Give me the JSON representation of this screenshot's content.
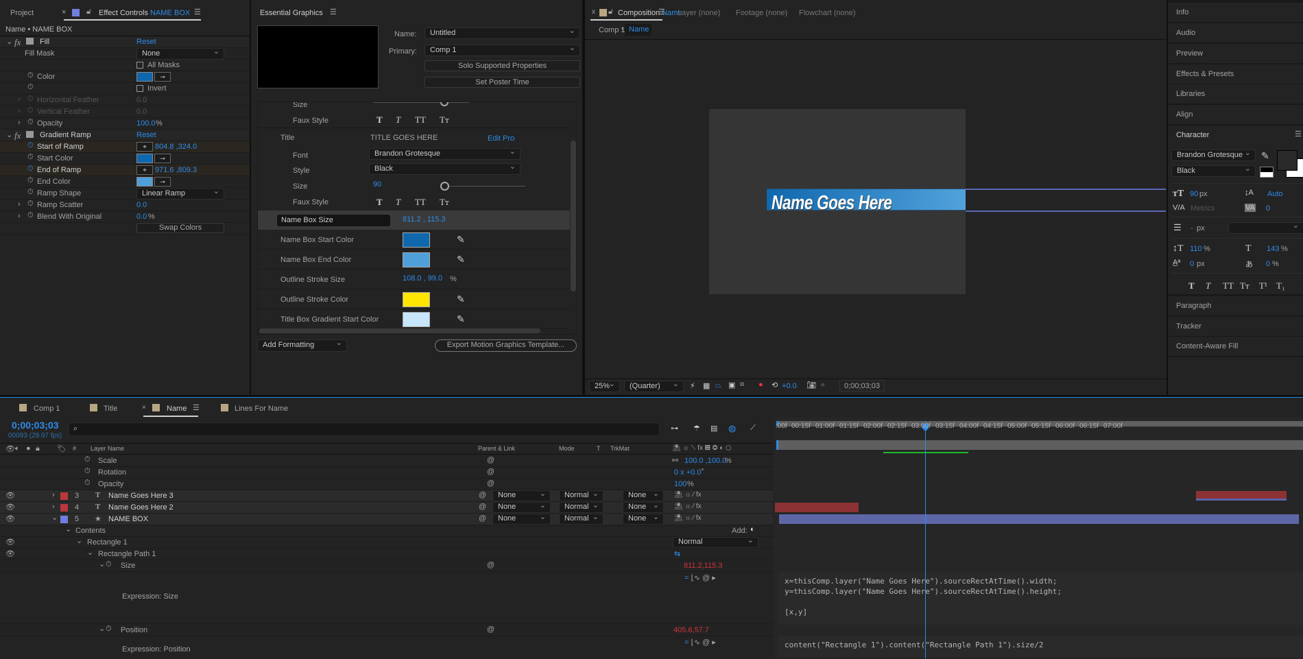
{
  "effect_controls": {
    "tab_project": "Project",
    "tab_title": "Effect Controls",
    "tab_layer": "NAME BOX",
    "breadcrumb": "Name • NAME BOX",
    "effects": [
      {
        "name": "Fill",
        "reset": "Reset",
        "props": [
          {
            "label": "Fill Mask",
            "value": "None"
          },
          {
            "label": "",
            "value": "All Masks"
          },
          {
            "label": "Color",
            "color": "#0f67ad"
          },
          {
            "label": "",
            "value": "Invert"
          },
          {
            "label": "Horizontal Feather",
            "value": "0.0"
          },
          {
            "label": "Vertical Feather",
            "value": "0.0"
          },
          {
            "label": "Opacity",
            "value": "100.0",
            "unit": "%"
          }
        ]
      },
      {
        "name": "Gradient Ramp",
        "reset": "Reset",
        "props": [
          {
            "label": "Start of Ramp",
            "value": "804.8 ,324.0"
          },
          {
            "label": "Start Color",
            "color": "#0f67ad"
          },
          {
            "label": "End of Ramp",
            "value": "971.6 ,809.3"
          },
          {
            "label": "End Color",
            "color": "#4f9fd9"
          },
          {
            "label": "Ramp Shape",
            "value": "Linear Ramp"
          },
          {
            "label": "Ramp Scatter",
            "value": "0.0"
          },
          {
            "label": "Blend With Original",
            "value": "0.0",
            "unit": "%"
          },
          {
            "label": "",
            "value": "Swap Colors"
          }
        ]
      }
    ]
  },
  "essential_graphics": {
    "title": "Essential Graphics",
    "name_label": "Name:",
    "name_value": "Untitled",
    "primary_label": "Primary:",
    "primary_value": "Comp 1",
    "solo": "Solo Supported Properties",
    "poster": "Set Poster Time",
    "top_size_label": "Size",
    "top_faux_label": "Faux Style",
    "title_group": {
      "label": "Title",
      "text": "TITLE GOES HERE",
      "edit": "Edit Properties",
      "font_label": "Font",
      "font": "Brandon Grotesque",
      "style_label": "Style",
      "style": "Black",
      "size_label": "Size",
      "size": "90",
      "faux_label": "Faux Style"
    },
    "faux_buttons": [
      "T",
      "T",
      "TT",
      "Tт"
    ],
    "props": [
      {
        "label": "Name Box Size",
        "value": "811.2 , 115.3"
      },
      {
        "label": "Name Box Start Color",
        "color": "#0f67ad"
      },
      {
        "label": "Name Box End Color",
        "color": "#4f9fd9"
      },
      {
        "label": "Outline Stroke Size",
        "value": "108.0 , 99.0",
        "unit": "%"
      },
      {
        "label": "Outline Stroke Color",
        "color": "#ffe600"
      },
      {
        "label": "Title Box Gradient Start Color",
        "color": "#c8e6fb"
      }
    ],
    "add_formatting": "Add Formatting",
    "export": "Export Motion Graphics Template..."
  },
  "composition": {
    "tab_prefix": "Composition",
    "tab_name": "Name",
    "layer_tab": "Layer (none)",
    "footage_tab": "Footage (none)",
    "flowchart_tab": "Flowchart (none)",
    "breadcrumb": [
      "Comp 1",
      "Name"
    ],
    "viewer_text": "Name Goes Here",
    "bar_start_color": "#0f67ad",
    "bar_end_color": "#52a3dc",
    "zoom": "25%",
    "resolution": "(Quarter)",
    "exposure": "+0.0",
    "timecode": "0;00;03;03"
  },
  "right_panel": {
    "panels_top": [
      "Info",
      "Audio",
      "Preview",
      "Effects & Presets",
      "Libraries",
      "Align"
    ],
    "character": {
      "title": "Character",
      "font": "Brandon Grotesque",
      "style": "Black",
      "size": "90",
      "size_unit": "px",
      "leading": "Auto",
      "kerning": "Metrics",
      "tracking": "0",
      "stroke": "-",
      "stroke_unit": "px",
      "vscale": "110",
      "vscale_unit": "%",
      "hscale": "143",
      "hscale_unit": "%",
      "baseline": "0",
      "baseline_unit": "px",
      "tsume": "0",
      "tsume_unit": "%",
      "styles": [
        "T",
        "T",
        "TT",
        "Tт",
        "T¹",
        "T₁"
      ]
    },
    "panels_bottom": [
      "Paragraph",
      "Tracker",
      "Content-Aware Fill"
    ]
  },
  "timeline": {
    "tabs": [
      "Comp 1",
      "Title",
      "Name",
      "Lines For Name"
    ],
    "active_tab": "Name",
    "timecode": "0;00;03;03",
    "frame_info": "00093 (29.97 fps)",
    "headers": {
      "num": "#",
      "layer_name": "Layer Name",
      "parent": "Parent & Link",
      "mode": "Mode",
      "t": "T",
      "trkmat": "TrkMat"
    },
    "transform_rows": [
      {
        "label": "Scale",
        "value": "100.0 ,100.0",
        "unit": "%"
      },
      {
        "label": "Rotation",
        "value": "0 x +0.0",
        "unit": "°"
      },
      {
        "label": "Opacity",
        "value": "100",
        "unit": "%"
      }
    ],
    "layers": [
      {
        "num": "3",
        "type": "T",
        "name": "Name Goes Here 3",
        "color": "#b8383b",
        "parent": "None",
        "mode": "Normal",
        "trkmat": "None"
      },
      {
        "num": "4",
        "type": "T",
        "name": "Name Goes Here 2",
        "color": "#b8383b",
        "parent": "None",
        "mode": "Normal",
        "trkmat": "None"
      },
      {
        "num": "5",
        "type": "★",
        "name": "NAME BOX",
        "color": "#6e7fe0",
        "parent": "None",
        "mode": "Normal",
        "trkmat": "None"
      }
    ],
    "contents": {
      "label": "Contents",
      "add": "Add:",
      "rect": "Rectangle 1",
      "rect_mode": "Normal",
      "path": "Rectangle Path 1",
      "size_label": "Size",
      "size_value": "811.2,115.3",
      "expr_size": "Expression: Size",
      "pos_label": "Position",
      "pos_value": "405.6,57.7",
      "expr_pos": "Expression: Position"
    },
    "ruler": [
      ":00f",
      "00:15f",
      "01:00f",
      "01:15f",
      "02:00f",
      "02:15f",
      "03:00f",
      "03:15f",
      "04:00f",
      "04:15f",
      "05:00f",
      "05:15f",
      "06:00f",
      "06:15f",
      "07:00f"
    ],
    "expression_size": [
      "x=thisComp.layer(\"Name Goes Here\").sourceRectAtTime().width;",
      "y=thisComp.layer(\"Name Goes Here\").sourceRectAtTime().height;",
      "",
      "[x,y]"
    ],
    "expression_position": "content(\"Rectangle 1\").content(\"Rectangle Path 1\").size/2"
  }
}
